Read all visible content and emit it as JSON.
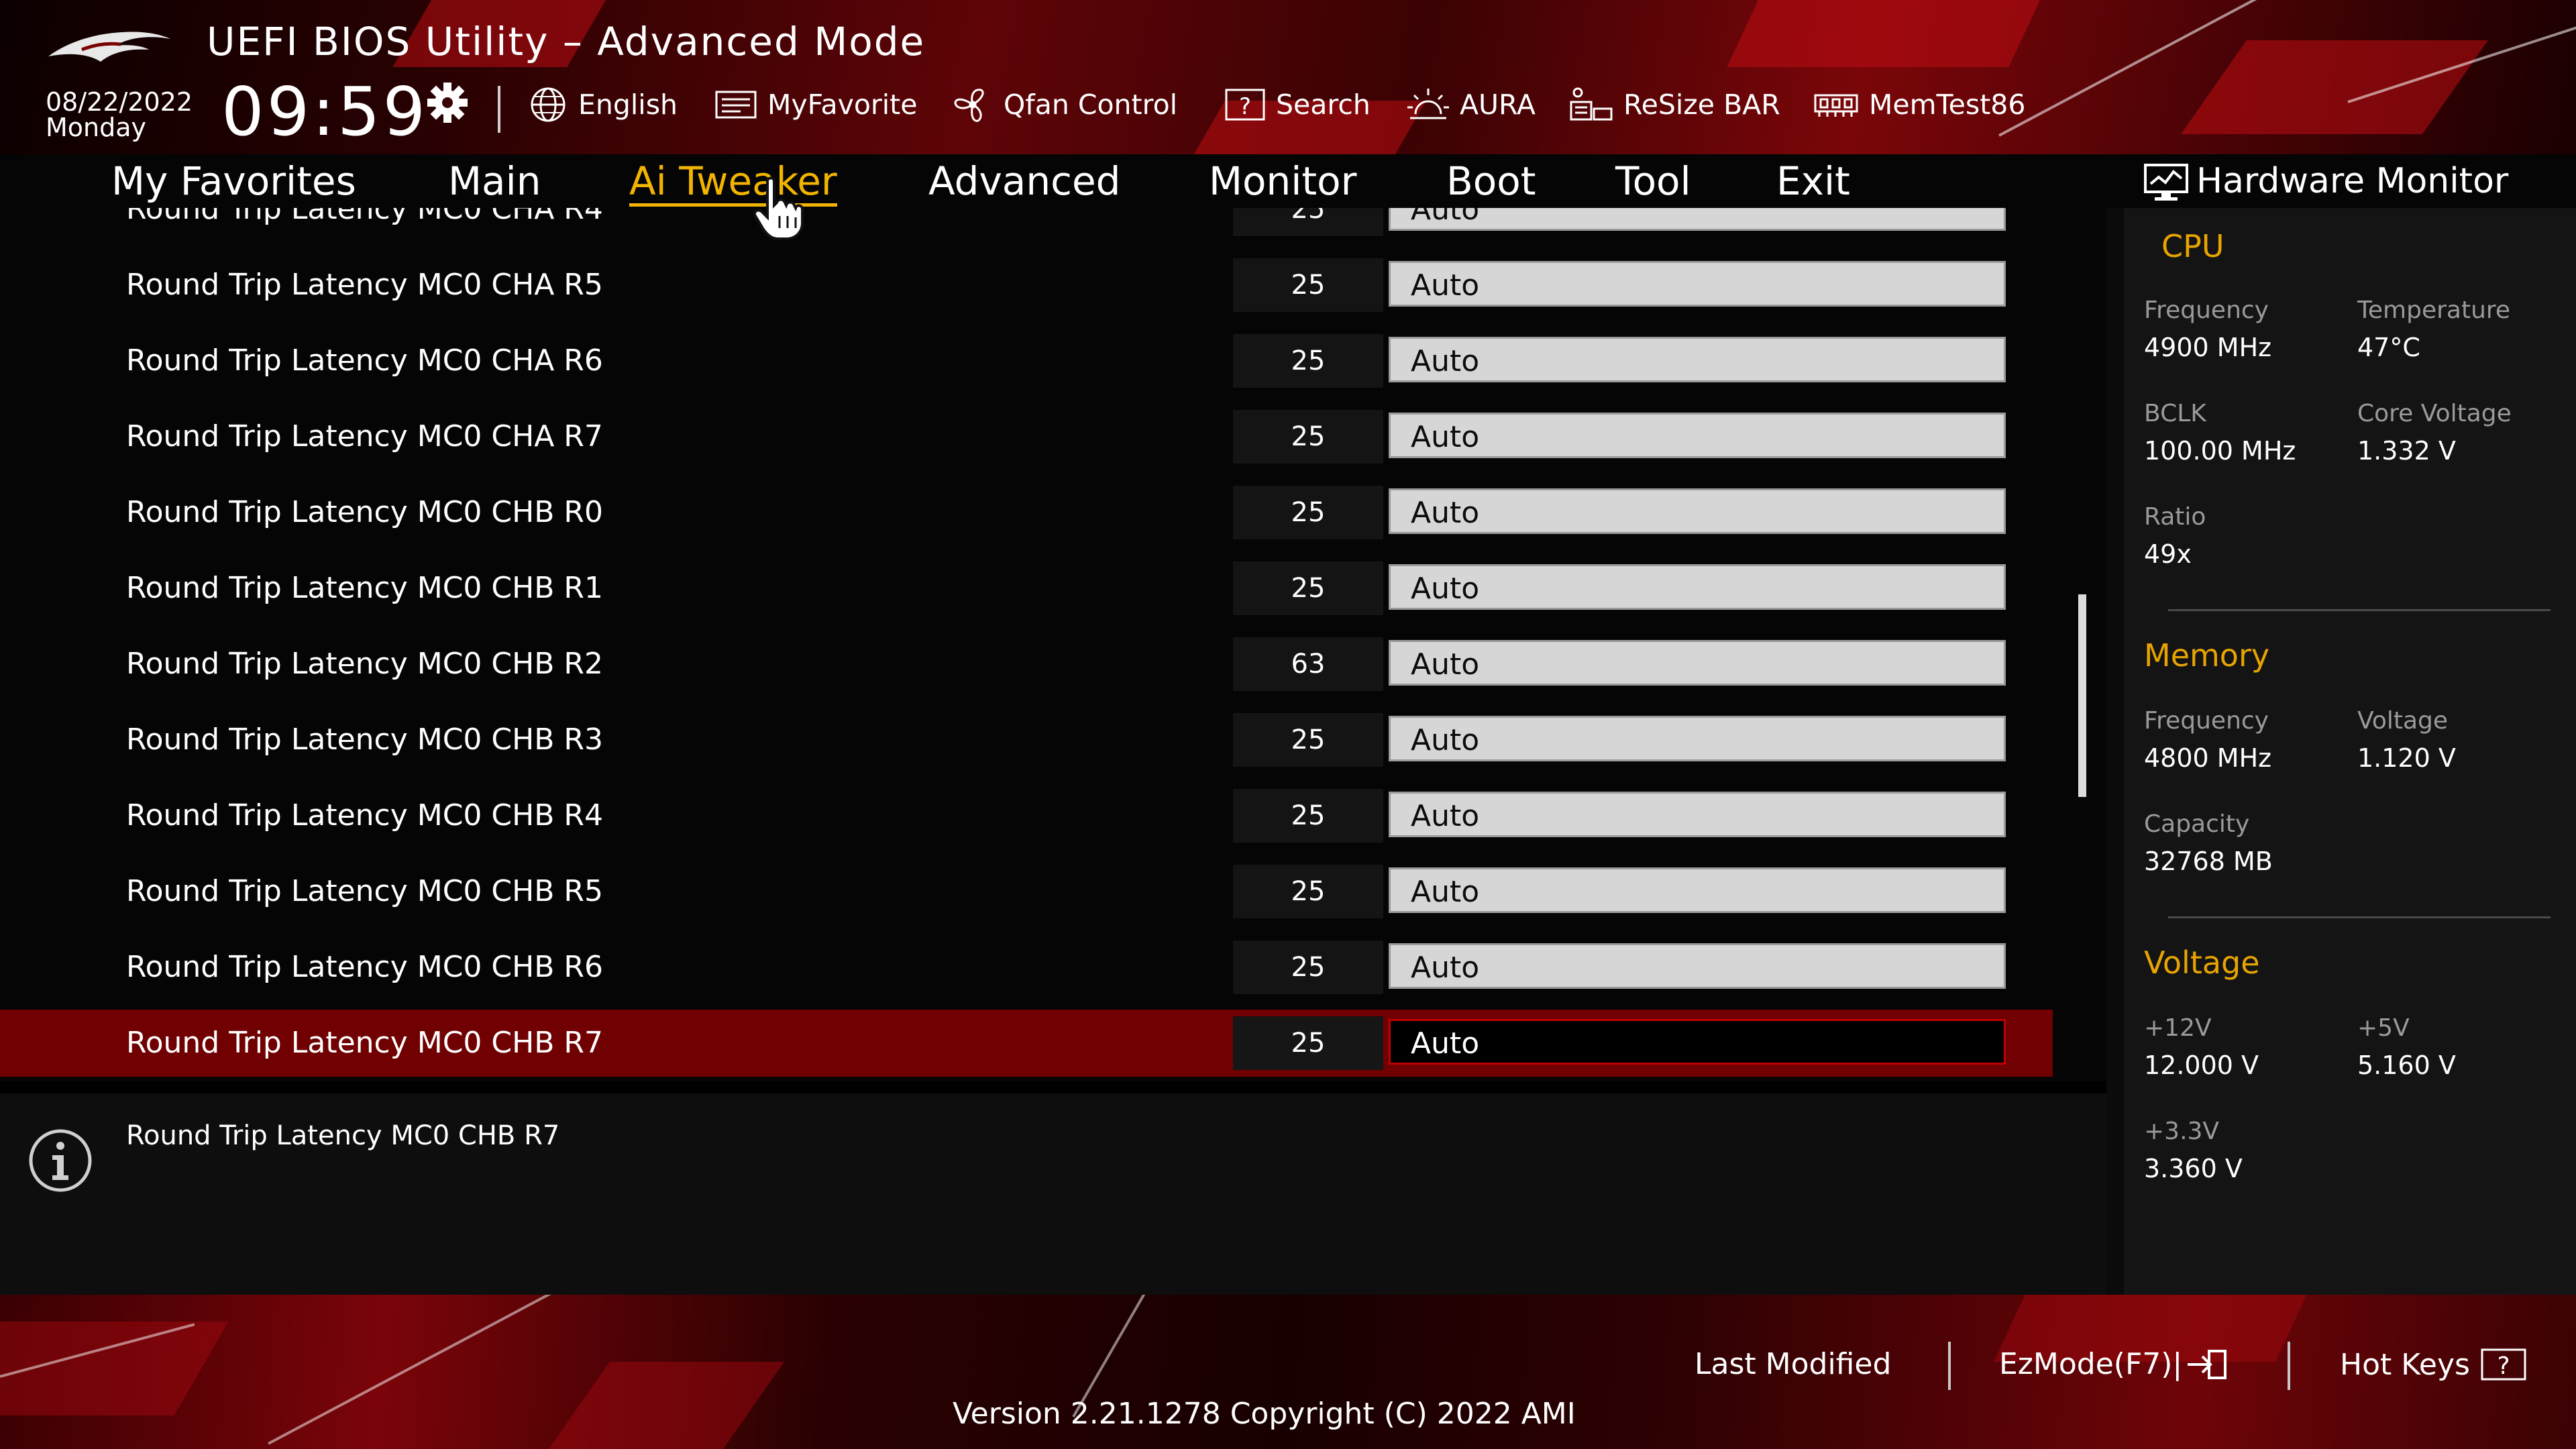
{
  "app": {
    "title": "UEFI BIOS Utility – Advanced Mode"
  },
  "header": {
    "date": "08/22/2022",
    "day": "Monday",
    "time": "09:59",
    "tools": [
      {
        "label": "English",
        "icon": "globe-icon"
      },
      {
        "label": "MyFavorite",
        "icon": "myfavorite-icon"
      },
      {
        "label": "Qfan Control",
        "icon": "fan-icon"
      },
      {
        "label": "Search",
        "icon": "search-help-icon"
      },
      {
        "label": "AURA",
        "icon": "aura-icon"
      },
      {
        "label": "ReSize BAR",
        "icon": "resize-bar-icon"
      },
      {
        "label": "MemTest86",
        "icon": "memtest-icon"
      }
    ]
  },
  "nav": {
    "tabs": [
      {
        "label": "My Favorites",
        "active": false
      },
      {
        "label": "Main",
        "active": false
      },
      {
        "label": "Ai Tweaker",
        "active": true
      },
      {
        "label": "Advanced",
        "active": false
      },
      {
        "label": "Monitor",
        "active": false
      },
      {
        "label": "Boot",
        "active": false
      },
      {
        "label": "Tool",
        "active": false
      },
      {
        "label": "Exit",
        "active": false
      }
    ]
  },
  "settings": {
    "rows": [
      {
        "label": "Round Trip Latency MC0 CHA R4",
        "value": "25",
        "option": "Auto",
        "selected": false
      },
      {
        "label": "Round Trip Latency MC0 CHA R5",
        "value": "25",
        "option": "Auto",
        "selected": false
      },
      {
        "label": "Round Trip Latency MC0 CHA R6",
        "value": "25",
        "option": "Auto",
        "selected": false
      },
      {
        "label": "Round Trip Latency MC0 CHA R7",
        "value": "25",
        "option": "Auto",
        "selected": false
      },
      {
        "label": "Round Trip Latency MC0 CHB R0",
        "value": "25",
        "option": "Auto",
        "selected": false
      },
      {
        "label": "Round Trip Latency MC0 CHB R1",
        "value": "25",
        "option": "Auto",
        "selected": false
      },
      {
        "label": "Round Trip Latency MC0 CHB R2",
        "value": "63",
        "option": "Auto",
        "selected": false
      },
      {
        "label": "Round Trip Latency MC0 CHB R3",
        "value": "25",
        "option": "Auto",
        "selected": false
      },
      {
        "label": "Round Trip Latency MC0 CHB R4",
        "value": "25",
        "option": "Auto",
        "selected": false
      },
      {
        "label": "Round Trip Latency MC0 CHB R5",
        "value": "25",
        "option": "Auto",
        "selected": false
      },
      {
        "label": "Round Trip Latency MC0 CHB R6",
        "value": "25",
        "option": "Auto",
        "selected": false
      },
      {
        "label": "Round Trip Latency MC0 CHB R7",
        "value": "25",
        "option": "Auto",
        "selected": true
      }
    ]
  },
  "help": {
    "text": "Round Trip Latency MC0 CHB R7"
  },
  "hwmon": {
    "title": "Hardware Monitor",
    "cpu": {
      "title": "CPU",
      "frequency_label": "Frequency",
      "frequency": "4900 MHz",
      "temperature_label": "Temperature",
      "temperature": "47°C",
      "bclk_label": "BCLK",
      "bclk": "100.00 MHz",
      "core_voltage_label": "Core Voltage",
      "core_voltage": "1.332 V",
      "ratio_label": "Ratio",
      "ratio": "49x"
    },
    "memory": {
      "title": "Memory",
      "frequency_label": "Frequency",
      "frequency": "4800 MHz",
      "voltage_label": "Voltage",
      "voltage": "1.120 V",
      "capacity_label": "Capacity",
      "capacity": "32768 MB"
    },
    "voltage": {
      "title": "Voltage",
      "v12_label": "+12V",
      "v12": "12.000 V",
      "v5_label": "+5V",
      "v5": "5.160 V",
      "v33_label": "+3.3V",
      "v33": "3.360 V"
    }
  },
  "footer": {
    "last_modified": "Last Modified",
    "ezmode": "EzMode(F7)|",
    "hotkeys": "Hot Keys",
    "version": "Version 2.21.1278 Copyright (C) 2022 AMI"
  },
  "colors": {
    "accent": "#f2b400",
    "hw_section": "#e8a400",
    "selected_row": "#700001",
    "brand_red": "#c00000"
  }
}
